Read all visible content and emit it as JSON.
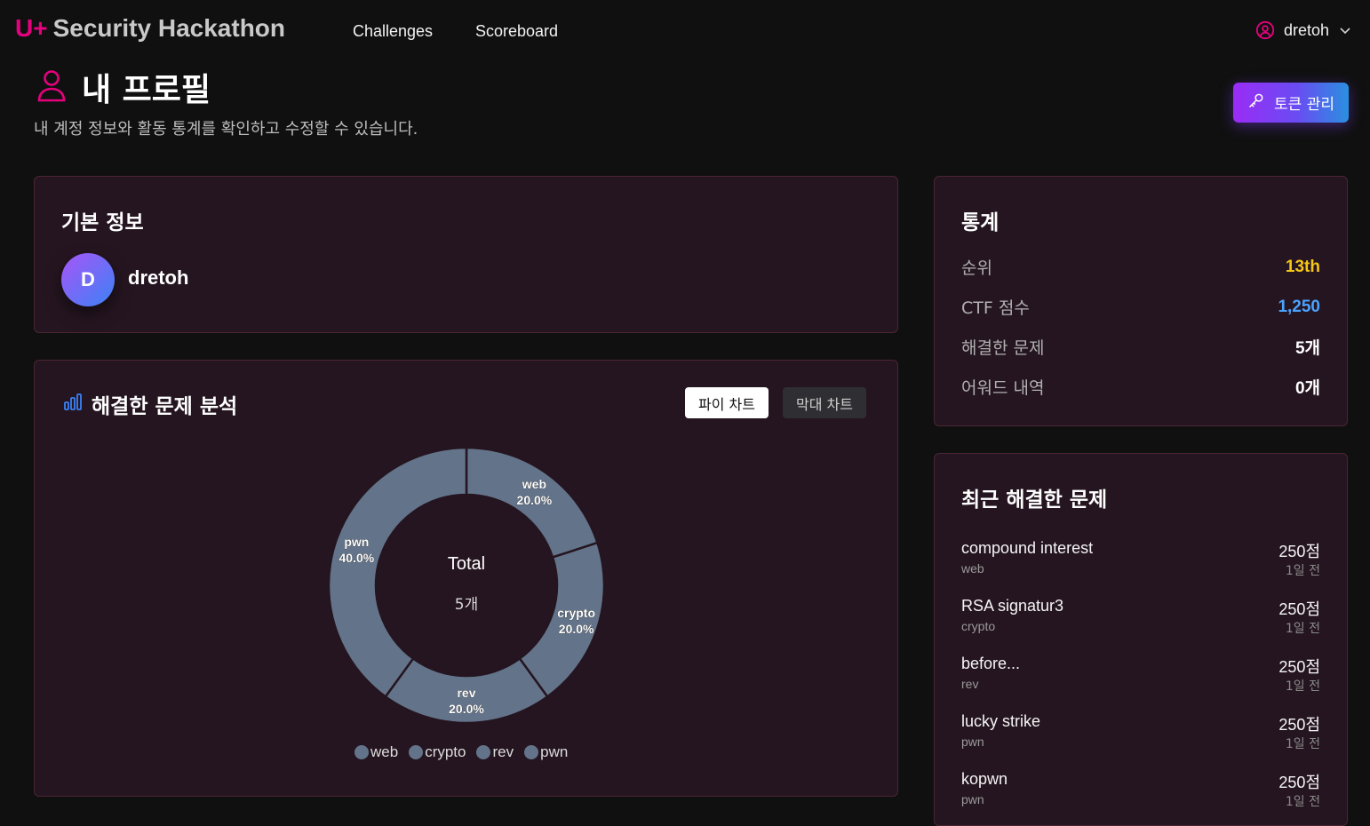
{
  "nav": {
    "brand_mark": "U+",
    "brand_text": "Security Hackathon",
    "links": [
      "Challenges",
      "Scoreboard"
    ],
    "username": "dretoh"
  },
  "page": {
    "title": "내 프로필",
    "subtitle": "내 계정 정보와 활동 통계를 확인하고 수정할 수 있습니다.",
    "token_button": "토큰 관리"
  },
  "basic": {
    "title": "기본 정보",
    "avatar_letter": "D",
    "name": "dretoh"
  },
  "analysis": {
    "title": "해결한 문제 분석",
    "tabs": [
      "파이 차트",
      "막대 차트"
    ],
    "center_label": "Total",
    "center_value": "5개"
  },
  "chart_data": {
    "type": "pie",
    "categories": [
      "web",
      "crypto",
      "rev",
      "pwn"
    ],
    "values": [
      1,
      1,
      1,
      2
    ],
    "labels": [
      "20.0%",
      "20.0%",
      "20.0%",
      "40.0%"
    ],
    "colors": [
      "#63748a",
      "#63748a",
      "#63748a",
      "#63748a"
    ],
    "legend_position": "bottom"
  },
  "stats": {
    "title": "통계",
    "rows": [
      {
        "label": "순위",
        "value": "13th",
        "color": "#f5c518"
      },
      {
        "label": "CTF 점수",
        "value": "1,250",
        "color": "#4aa3ff"
      },
      {
        "label": "해결한 문제",
        "value": "5개",
        "color": "#ffffff"
      },
      {
        "label": "어워드 내역",
        "value": "0개",
        "color": "#ffffff"
      }
    ]
  },
  "recent": {
    "title": "최근 해결한 문제",
    "items": [
      {
        "name": "compound interest",
        "category": "web",
        "points": "250점",
        "time": "1일 전"
      },
      {
        "name": "RSA signatur3",
        "category": "crypto",
        "points": "250점",
        "time": "1일 전"
      },
      {
        "name": "before...",
        "category": "rev",
        "points": "250점",
        "time": "1일 전"
      },
      {
        "name": "lucky strike",
        "category": "pwn",
        "points": "250점",
        "time": "1일 전"
      },
      {
        "name": "kopwn",
        "category": "pwn",
        "points": "250점",
        "time": "1일 전"
      }
    ]
  }
}
